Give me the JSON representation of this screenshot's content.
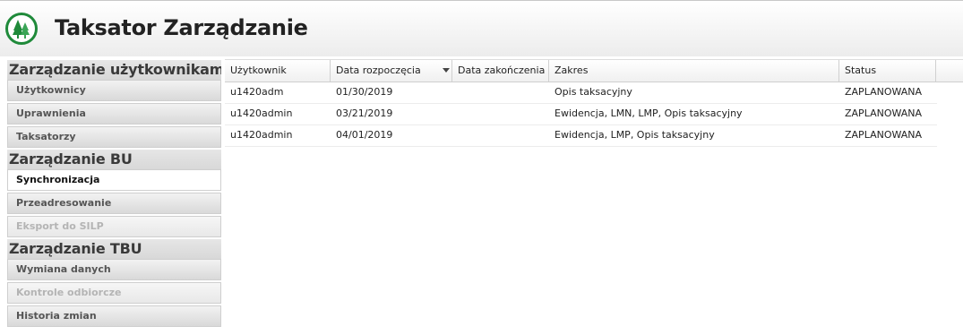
{
  "app": {
    "title": "Taksator Zarządzanie",
    "logo_icon": "tree-logo-icon",
    "brand_color": "#1f8a3a"
  },
  "sidebar": {
    "sections": [
      {
        "title": "Zarządzanie użytkownikami",
        "items": [
          {
            "label": "Użytkownicy",
            "state": "normal"
          },
          {
            "label": "Uprawnienia",
            "state": "normal"
          },
          {
            "label": "Taksatorzy",
            "state": "normal"
          }
        ]
      },
      {
        "title": "Zarządzanie BU",
        "items": [
          {
            "label": "Synchronizacja",
            "state": "active"
          },
          {
            "label": "Przeadresowanie",
            "state": "normal"
          },
          {
            "label": "Eksport do SILP",
            "state": "disabled"
          }
        ]
      },
      {
        "title": "Zarządzanie TBU",
        "items": [
          {
            "label": "Wymiana danych",
            "state": "normal"
          },
          {
            "label": "Kontrole odbiorcze",
            "state": "disabled"
          },
          {
            "label": "Historia zmian",
            "state": "normal"
          }
        ]
      }
    ]
  },
  "grid": {
    "columns": [
      "Użytkownik",
      "Data rozpoczęcia",
      "Data zakończenia",
      "Zakres",
      "Status"
    ],
    "sort_indicator": "sort-desc-icon",
    "rows": [
      [
        "u1420adm",
        "01/30/2019",
        "",
        "Opis taksacyjny",
        "ZAPLANOWANA"
      ],
      [
        "u1420admin",
        "03/21/2019",
        "",
        "Ewidencja, LMN, LMP, Opis taksacyjny",
        "ZAPLANOWANA"
      ],
      [
        "u1420admin",
        "04/01/2019",
        "",
        "Ewidencja, LMP, Opis taksacyjny",
        "ZAPLANOWANA"
      ]
    ]
  }
}
